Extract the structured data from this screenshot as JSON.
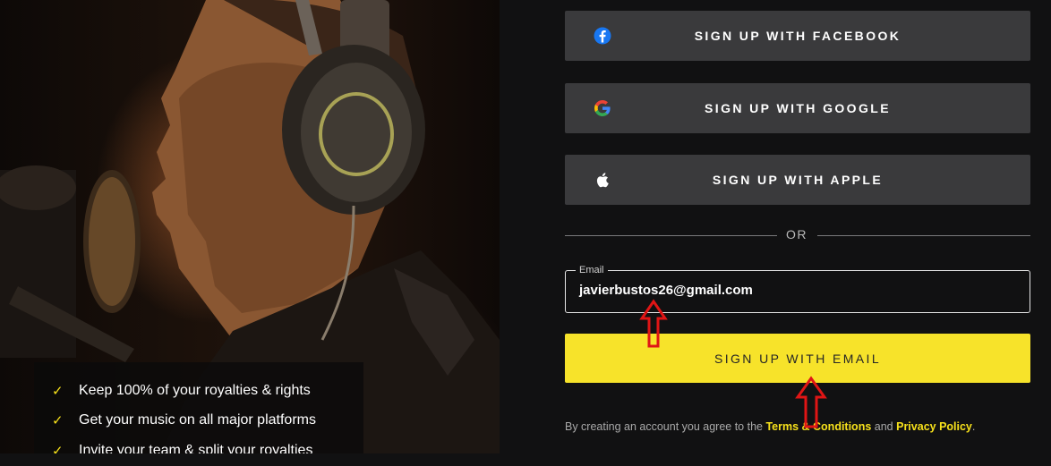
{
  "features": [
    {
      "icon": "check-icon",
      "text": "Keep 100% of your royalties & rights"
    },
    {
      "icon": "check-icon",
      "text": "Get your music on all major platforms"
    },
    {
      "icon": "check-icon",
      "text": "Invite your team & split your royalties"
    }
  ],
  "check_glyph": "✓",
  "social": {
    "facebook": {
      "label": "SIGN UP WITH FACEBOOK",
      "icon": "facebook-icon"
    },
    "google": {
      "label": "SIGN UP WITH GOOGLE",
      "icon": "google-icon"
    },
    "apple": {
      "label": "SIGN UP WITH APPLE",
      "icon": "apple-icon"
    }
  },
  "divider": {
    "text": "OR"
  },
  "email": {
    "label": "Email",
    "value": "javierbustos26@gmail.com"
  },
  "email_button": {
    "label": "SIGN UP WITH EMAIL"
  },
  "legal": {
    "prefix": "By creating an account you agree to the ",
    "terms": "Terms & Conditions",
    "and": " and ",
    "privacy": "Privacy Policy",
    "suffix": "."
  },
  "colors": {
    "accent": "#f7e32a",
    "button_bg": "#3a3a3c",
    "page_bg": "#111112",
    "annotation_arrow": "#e01515"
  }
}
